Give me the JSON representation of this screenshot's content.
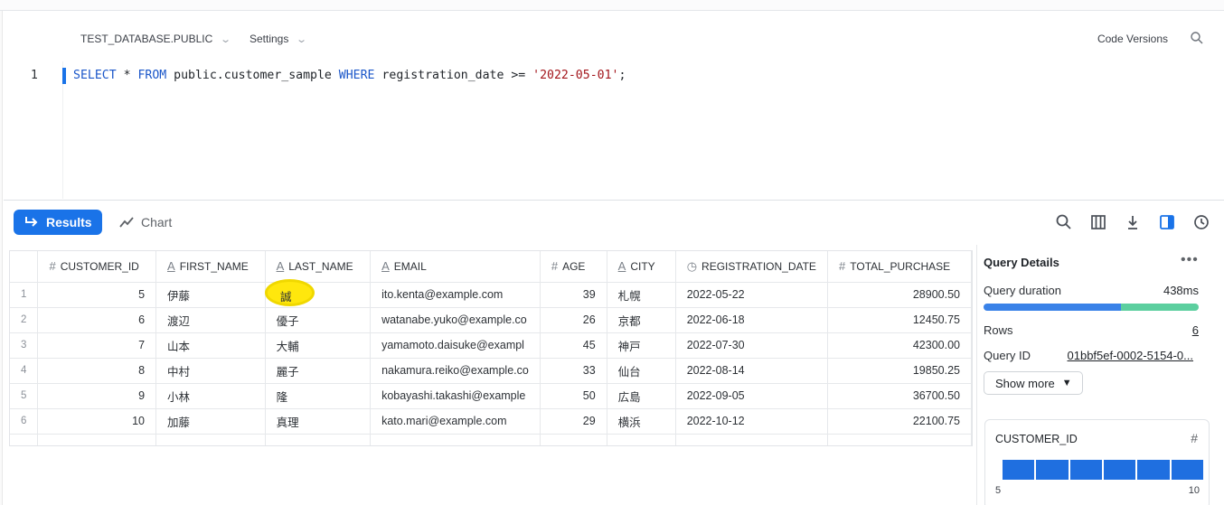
{
  "header": {
    "database": "TEST_DATABASE.PUBLIC",
    "settings": "Settings",
    "code_versions": "Code Versions"
  },
  "editor": {
    "line_number": "1",
    "tokens": [
      {
        "t": "SELECT",
        "k": "kw"
      },
      {
        "t": " * ",
        "k": ""
      },
      {
        "t": "FROM",
        "k": "kw"
      },
      {
        "t": " public.customer_sample ",
        "k": ""
      },
      {
        "t": "WHERE",
        "k": "kw"
      },
      {
        "t": " registration_date >= ",
        "k": ""
      },
      {
        "t": "'2022-05-01'",
        "k": "str"
      },
      {
        "t": ";",
        "k": ""
      }
    ]
  },
  "results_bar": {
    "results_label": "Results",
    "chart_label": "Chart"
  },
  "table": {
    "columns": [
      {
        "name": "CUSTOMER_ID",
        "type": "#"
      },
      {
        "name": "FIRST_NAME",
        "type": "A"
      },
      {
        "name": "LAST_NAME",
        "type": "A"
      },
      {
        "name": "EMAIL",
        "type": "A"
      },
      {
        "name": "AGE",
        "type": "#"
      },
      {
        "name": "CITY",
        "type": "A"
      },
      {
        "name": "REGISTRATION_DATE",
        "type": "clock"
      },
      {
        "name": "TOTAL_PURCHASE",
        "type": "#"
      }
    ],
    "rows": [
      [
        "1",
        "5",
        "伊藤",
        "誠",
        "ito.kenta@example.com",
        "39",
        "札幌",
        "2022-05-22",
        "28900.50"
      ],
      [
        "2",
        "6",
        "渡辺",
        "優子",
        "watanabe.yuko@example.co",
        "26",
        "京都",
        "2022-06-18",
        "12450.75"
      ],
      [
        "3",
        "7",
        "山本",
        "大輔",
        "yamamoto.daisuke@exampl",
        "45",
        "神戸",
        "2022-07-30",
        "42300.00"
      ],
      [
        "4",
        "8",
        "中村",
        "麗子",
        "nakamura.reiko@example.co",
        "33",
        "仙台",
        "2022-08-14",
        "19850.25"
      ],
      [
        "5",
        "9",
        "小林",
        "隆",
        "kobayashi.takashi@example",
        "50",
        "広島",
        "2022-09-05",
        "36700.50"
      ],
      [
        "6",
        "10",
        "加藤",
        "真理",
        "kato.mari@example.com",
        "29",
        "横浜",
        "2022-10-12",
        "22100.75"
      ]
    ]
  },
  "query_details": {
    "title": "Query Details",
    "duration_label": "Query duration",
    "duration_value": "438ms",
    "duration_split": 0.64,
    "rows_label": "Rows",
    "rows_value": "6",
    "query_id_label": "Query ID",
    "query_id_value": "01bbf5ef-0002-5154-0...",
    "show_more": "Show more"
  },
  "column_card": {
    "name": "CUSTOMER_ID",
    "type_icon": "#",
    "min": "5",
    "max": "10",
    "bins": 6
  },
  "colors": {
    "accent": "#1a73e8",
    "highlight": "#ffe600"
  }
}
